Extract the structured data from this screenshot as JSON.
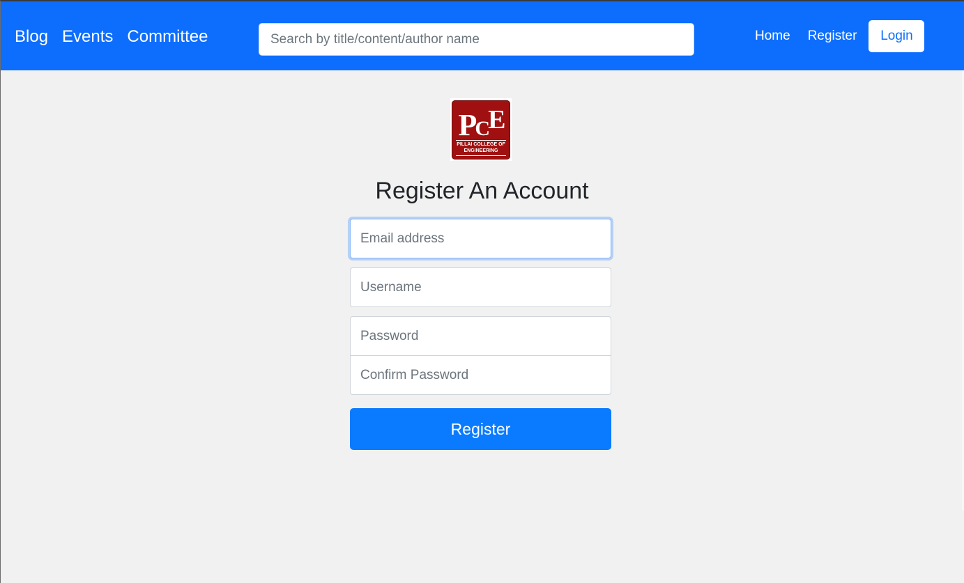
{
  "navbar": {
    "left_links": [
      "Blog",
      "Events",
      "Committee"
    ],
    "search": {
      "value": "",
      "placeholder": "Search by title/content/author name"
    },
    "right_links": {
      "home": "Home",
      "register": "Register",
      "login": "Login"
    },
    "colors": {
      "background": "#0d6efd",
      "text": "#ffffff"
    }
  },
  "logo": {
    "letters": {
      "p": "P",
      "c": "C",
      "e": "E"
    },
    "subtitle": "PILLAI COLLEGE OF\nENGINEERING",
    "color": "#a01010"
  },
  "form": {
    "title": "Register An Account",
    "fields": {
      "email": {
        "value": "",
        "placeholder": "Email address",
        "focused": true
      },
      "username": {
        "value": "",
        "placeholder": "Username"
      },
      "password": {
        "value": "",
        "placeholder": "Password"
      },
      "confirm_password": {
        "value": "",
        "placeholder": "Confirm Password"
      }
    },
    "submit_label": "Register",
    "submit_color": "#0a7bff"
  },
  "page": {
    "background": "#f1f1f1"
  }
}
